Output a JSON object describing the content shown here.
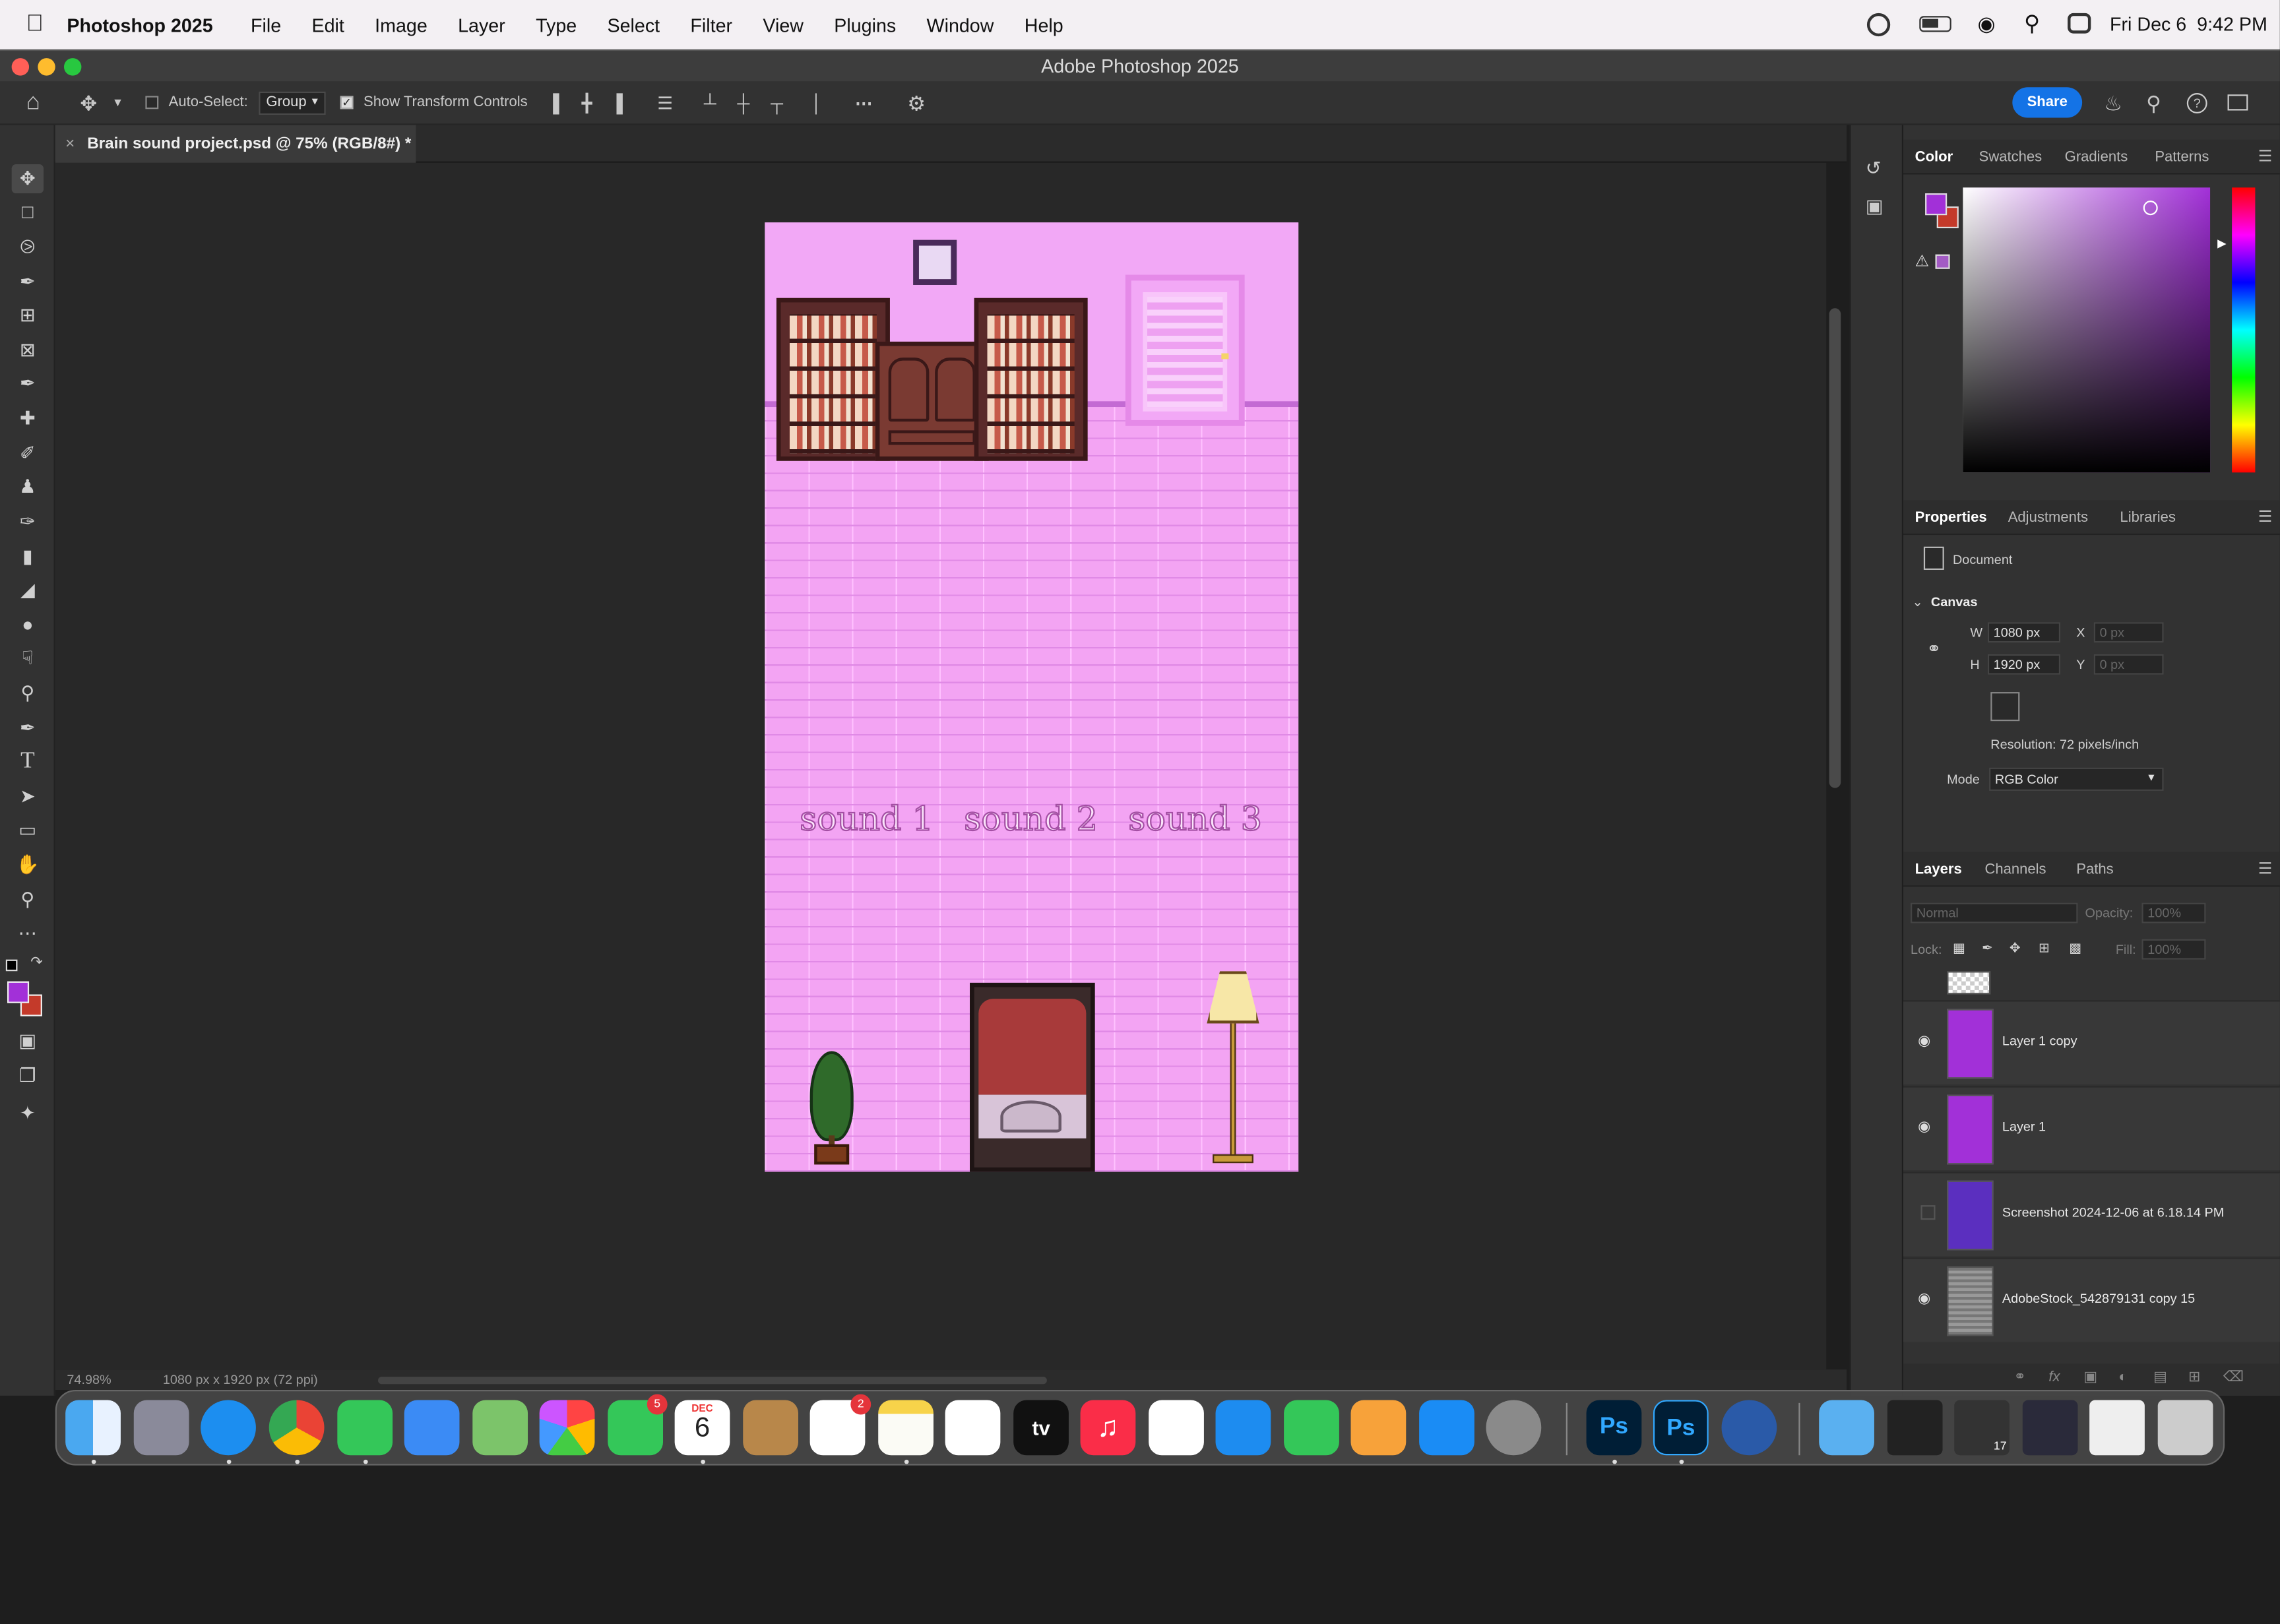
{
  "menubar": {
    "app_name": "Photoshop 2025",
    "items": [
      "File",
      "Edit",
      "Image",
      "Layer",
      "Type",
      "Select",
      "Filter",
      "View",
      "Plugins",
      "Window",
      "Help"
    ],
    "clock": "Fri Dec 6  9:42 PM"
  },
  "window": {
    "title": "Adobe Photoshop 2025"
  },
  "options_bar": {
    "auto_select_label": "Auto-Select:",
    "auto_select_value": "Group",
    "show_transform_label": "Show Transform Controls",
    "share_label": "Share"
  },
  "document": {
    "tab_title": "Brain sound project.psd @ 75% (RGB/8#) *",
    "zoom_status": "74.98%",
    "size_status": "1080 px x 1920 px (72 ppi)",
    "sound_labels": [
      "sound 1",
      "sound 2",
      "sound 3"
    ]
  },
  "color_panel": {
    "tabs": [
      "Color",
      "Swatches",
      "Gradients",
      "Patterns"
    ],
    "foreground": "#a230d8",
    "background": "#c43a2a"
  },
  "properties_panel": {
    "tabs": [
      "Properties",
      "Adjustments",
      "Libraries"
    ],
    "document_label": "Document",
    "canvas_label": "Canvas",
    "w_label": "W",
    "w_value": "1080 px",
    "h_label": "H",
    "h_value": "1920 px",
    "x_label": "X",
    "x_placeholder": "0 px",
    "y_label": "Y",
    "y_placeholder": "0 px",
    "resolution": "Resolution: 72 pixels/inch",
    "mode_label": "Mode",
    "mode_value": "RGB Color"
  },
  "layers_panel": {
    "tabs": [
      "Layers",
      "Channels",
      "Paths"
    ],
    "blend_mode": "Normal",
    "opacity_label": "Opacity:",
    "opacity_value": "100%",
    "lock_label": "Lock:",
    "fill_label": "Fill:",
    "fill_value": "100%",
    "layers": [
      {
        "name": "Layer 1 copy",
        "visible": true
      },
      {
        "name": "Layer 1",
        "visible": true
      },
      {
        "name": "Screenshot 2024-12-06 at 6.18.14 PM",
        "visible": false
      },
      {
        "name": "AdobeStock_542879131 copy 15",
        "visible": true
      }
    ]
  },
  "dock": {
    "calendar_month": "DEC",
    "calendar_day": "6",
    "facetime_badge": "5",
    "reminders_badge": "2",
    "ps_label": "Ps",
    "tv_label": "tv",
    "recent_calendar_day": "17"
  }
}
